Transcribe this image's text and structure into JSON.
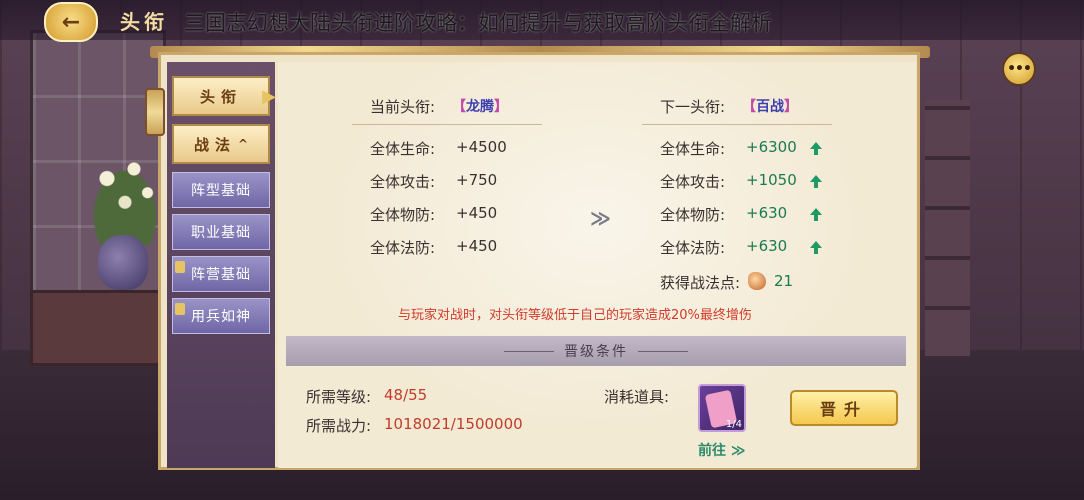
{
  "header": {
    "back_icon": "←",
    "title": "头衔",
    "overlay_caption": "三国志幻想大陆头衔进阶攻略：如何提升与获取高阶头衔全解析",
    "chat_icon": "•••"
  },
  "sidebar": {
    "items": [
      {
        "label": "头衔",
        "active": true
      },
      {
        "label": "战法",
        "caret": "^"
      },
      {
        "label": "阵型基础"
      },
      {
        "label": "职业基础"
      },
      {
        "label": "阵营基础",
        "locked": true
      },
      {
        "label": "用兵如神",
        "locked": true
      }
    ]
  },
  "current": {
    "label": "当前头衔:",
    "rank_open": "【",
    "rank": "龙腾",
    "rank_close": "】",
    "stats": [
      {
        "label": "全体生命:",
        "value": "+4500"
      },
      {
        "label": "全体攻击:",
        "value": "+750"
      },
      {
        "label": "全体物防:",
        "value": "+450"
      },
      {
        "label": "全体法防:",
        "value": "+450"
      }
    ]
  },
  "next": {
    "label": "下一头衔:",
    "rank_open": "【",
    "rank": "百战",
    "rank_close": "】",
    "stats": [
      {
        "label": "全体生命:",
        "value": "+6300"
      },
      {
        "label": "全体攻击:",
        "value": "+1050"
      },
      {
        "label": "全体物防:",
        "value": "+630"
      },
      {
        "label": "全体法防:",
        "value": "+630"
      }
    ],
    "points_label": "获得战法点:",
    "points_value": "21"
  },
  "transition_icon": "≫",
  "pvp_note": "与玩家对战时，对头衔等级低于自己的玩家造成20%最终增伤",
  "conditions": {
    "title": "晋级条件",
    "level_label": "所需等级:",
    "level_value": "48/55",
    "power_label": "所需战力:",
    "power_value": "1018021/1500000",
    "consume_label": "消耗道具:",
    "item_count": "1/4",
    "goto_label": "前往 ≫",
    "promote_label": "晋升"
  }
}
